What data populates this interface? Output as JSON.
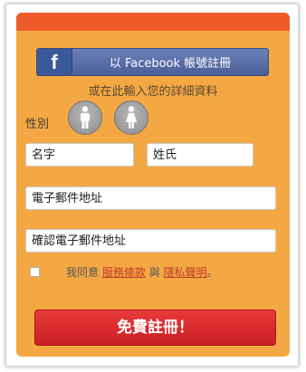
{
  "facebook_button": {
    "logo": "f",
    "label": "以 Facebook 帳號註冊"
  },
  "subtitle": "或在此輸入您的詳細資料",
  "gender": {
    "label": "性別",
    "male_icon": "male-person-icon",
    "female_icon": "female-person-icon"
  },
  "fields": {
    "first_name_placeholder": "名字",
    "last_name_placeholder": "姓氏",
    "email_placeholder": "電子郵件地址",
    "confirm_email_placeholder": "確認電子郵件地址"
  },
  "agreement": {
    "prefix": "我同意",
    "terms_link": "服務條款",
    "conjunction": "與",
    "privacy_link": "隱私聲明",
    "suffix": "。"
  },
  "submit_label": "免費註冊！",
  "colors": {
    "panel": "#f4a844",
    "header_bar": "#ef5a2a",
    "facebook": "#3b5998",
    "submit": "#d7262c",
    "link": "#c03c2a"
  }
}
